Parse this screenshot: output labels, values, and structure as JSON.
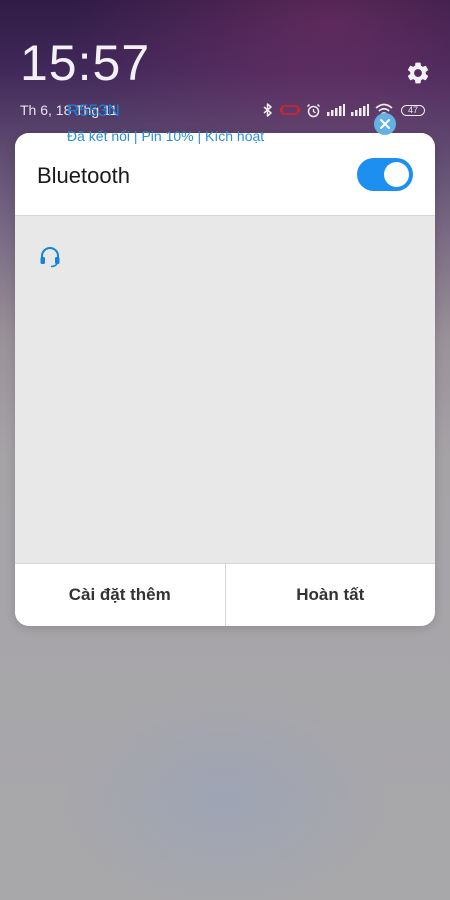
{
  "status_bar": {
    "time": "15:57",
    "date": "Th 6, 18 Thg 11",
    "battery_level": "47",
    "icons": [
      "bluetooth-icon",
      "vibrate-icon",
      "alarm-icon",
      "signal-icon",
      "signal-icon",
      "wifi-icon",
      "battery-icon"
    ]
  },
  "dialog": {
    "title": "Bluetooth",
    "toggle_on": true,
    "devices": [
      {
        "name": "R553N",
        "status": "Đã kết nối | Pin 10% | Kích hoạt",
        "icon": "headset-icon",
        "action_icon": "close-icon"
      }
    ],
    "buttons": {
      "more_settings": "Cài đặt thêm",
      "done": "Hoàn tất"
    }
  },
  "colors": {
    "accent": "#1d8ff0",
    "device_text": "#1583db",
    "card_body": "#e8e8e8"
  }
}
